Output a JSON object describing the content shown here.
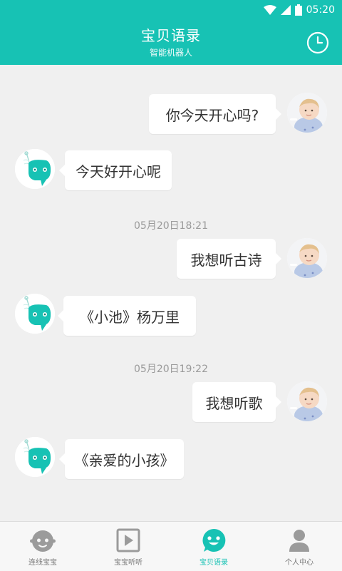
{
  "status_bar": {
    "time": "05:20"
  },
  "header": {
    "title": "宝贝语录",
    "subtitle": "智能机器人",
    "history_icon": "clock-icon"
  },
  "messages": [
    {
      "side": "right",
      "text": "你今天开心吗?"
    },
    {
      "side": "left",
      "text": "今天好开心呢"
    },
    {
      "type": "time",
      "text": "05月20日18:21"
    },
    {
      "side": "right",
      "text": "我想听古诗"
    },
    {
      "side": "left",
      "text": "《小池》杨万里"
    },
    {
      "type": "time",
      "text": "05月20日19:22"
    },
    {
      "side": "right",
      "text": "我想听歌"
    },
    {
      "side": "left",
      "text": "《亲爱的小孩》"
    }
  ],
  "tabs": [
    {
      "label": "连线宝宝",
      "icon": "baby-face-icon"
    },
    {
      "label": "宝宝听听",
      "icon": "play-icon"
    },
    {
      "label": "宝贝语录",
      "icon": "smile-chat-icon",
      "active": true
    },
    {
      "label": "个人中心",
      "icon": "person-icon"
    }
  ],
  "colors": {
    "accent": "#17c2b4",
    "background": "#f0f0f0",
    "bubble": "#ffffff"
  }
}
